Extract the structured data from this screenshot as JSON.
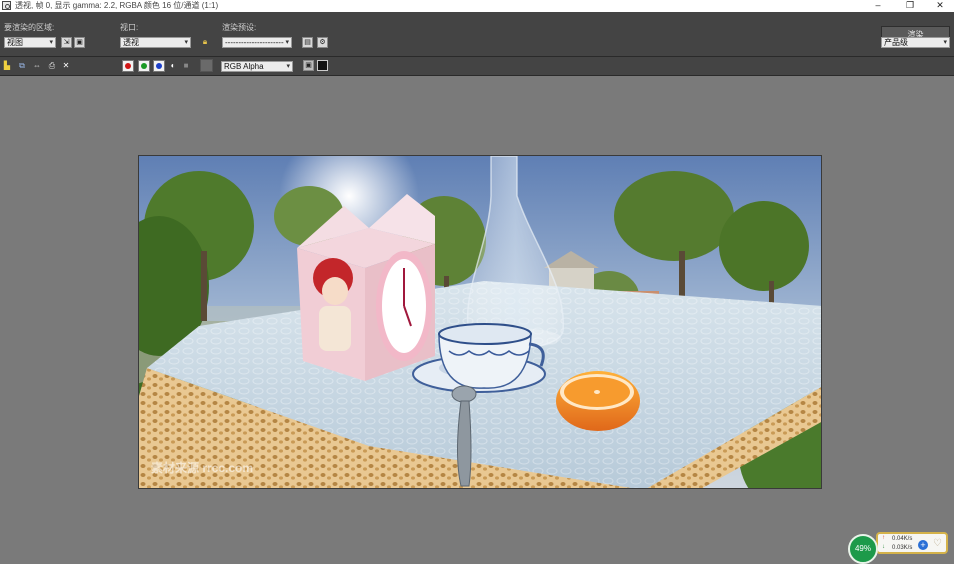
{
  "window": {
    "title": "透视, 帧 0, 显示 gamma: 2.2, RGBA 颜色 16 位/通道 (1:1)"
  },
  "toolbar": {
    "area_label": "要渲染的区域:",
    "area_value": "视图",
    "viewport_label": "视口:",
    "viewport_value": "透视",
    "preset_label": "渲染预设:",
    "preset_value": "----------------------",
    "render_button": "渲染",
    "quality_value": "产品级"
  },
  "toolbar2": {
    "channel_value": "RGB Alpha",
    "colors": {
      "red": "#d01515",
      "green": "#1a9a25",
      "blue": "#1c3fc8"
    }
  },
  "net_widget": {
    "percent": "49%",
    "upload": "0.04K/s",
    "download": "0.03K/s"
  },
  "render_image": {
    "watermark": "素材来源 rrcc.com"
  }
}
